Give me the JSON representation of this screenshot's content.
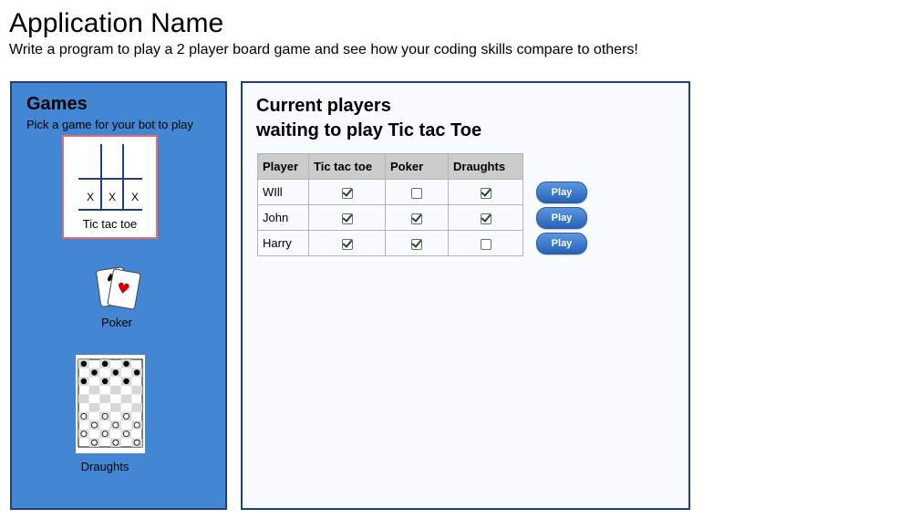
{
  "app": {
    "title": "Application Name",
    "subtitle": "Write a program to play a 2 player board game and see how your coding skills compare to others!"
  },
  "games": {
    "title": "Games",
    "subtitle": "Pick a game for your bot to play",
    "items": [
      {
        "label": "Tic tac toe",
        "icon": "tic-tac-toe-board",
        "selected": true
      },
      {
        "label": "Poker",
        "icon": "playing-cards"
      },
      {
        "label": "Draughts",
        "icon": "draughts-board"
      }
    ]
  },
  "players": {
    "title_line1": "Current players",
    "title_line2": "waiting to play Tic tac Toe",
    "columns": [
      "Player",
      "Tic tac toe",
      "Poker",
      "Draughts"
    ],
    "rows": [
      {
        "name": "WIll",
        "tic_tac_toe": true,
        "poker": false,
        "draughts": true,
        "action": "Play"
      },
      {
        "name": "John",
        "tic_tac_toe": true,
        "poker": true,
        "draughts": true,
        "action": "Play"
      },
      {
        "name": "Harry",
        "tic_tac_toe": true,
        "poker": true,
        "draughts": false,
        "action": "Play"
      }
    ]
  },
  "ttt_marks": [
    "X",
    "X",
    "X"
  ],
  "colors": {
    "games_panel": "#4386d3",
    "panel_border": "#1f3f80",
    "selected_border": "#e96c6c",
    "button": "#2f6fc7"
  }
}
